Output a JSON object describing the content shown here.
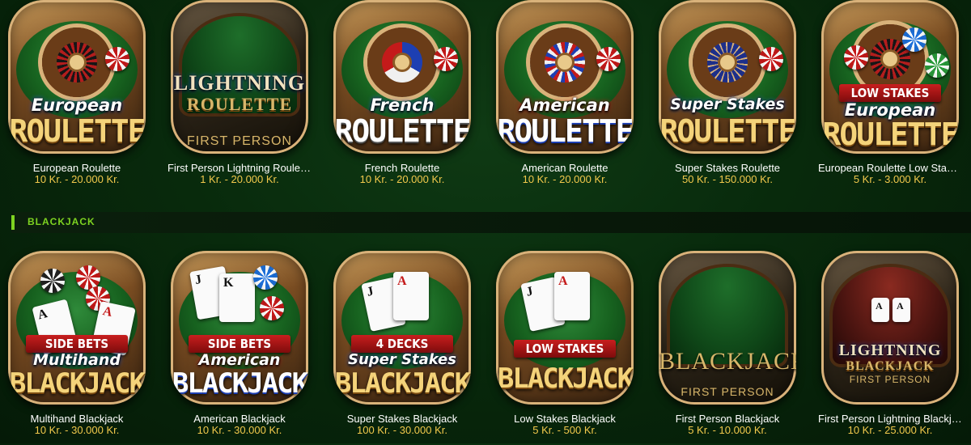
{
  "roulette_games": [
    {
      "badge_top": "European",
      "badge_main": "ROULETTE",
      "name": "European Roulette",
      "stakes": "10 Kr. - 20.000 Kr."
    },
    {
      "badge_top": "LIGHTNING",
      "badge_main": "ROULETTE",
      "badge_extra": "FIRST PERSON",
      "name": "First Person Lightning Roulette",
      "stakes": "1 Kr. - 20.000 Kr."
    },
    {
      "badge_top": "French",
      "badge_main": "ROULETTE",
      "name": "French Roulette",
      "stakes": "10 Kr. - 20.000 Kr."
    },
    {
      "badge_top": "American",
      "badge_main": "ROULETTE",
      "name": "American Roulette",
      "stakes": "10 Kr. - 20.000 Kr."
    },
    {
      "badge_top": "Super Stakes",
      "badge_main": "ROULETTE",
      "name": "Super Stakes Roulette",
      "stakes": "50 Kr. - 150.000 Kr."
    },
    {
      "badge_ribbon": "LOW STAKES",
      "badge_top": "European",
      "badge_main": "ROULETTE",
      "name": "European Roulette Low Stakes",
      "stakes": "5 Kr. - 3.000 Kr."
    }
  ],
  "section": {
    "label": "BLACKJACK",
    "accent_color": "#7ed321"
  },
  "blackjack_games": [
    {
      "badge_ribbon": "SIDE BETS",
      "badge_top": "Multihand",
      "badge_main": "BLACKJACK",
      "name": "Multihand Blackjack",
      "stakes": "10 Kr. - 30.000 Kr."
    },
    {
      "badge_ribbon": "SIDE BETS",
      "badge_top": "American",
      "badge_main": "BLACKJACK",
      "name": "American Blackjack",
      "stakes": "10 Kr. - 30.000 Kr."
    },
    {
      "badge_ribbon": "4 DECKS",
      "badge_top": "Super Stakes",
      "badge_main": "BLACKJACK",
      "name": "Super Stakes Blackjack",
      "stakes": "100 Kr. - 30.000 Kr."
    },
    {
      "badge_ribbon": "LOW STAKES",
      "badge_main": "BLACKJACK",
      "name": "Low Stakes Blackjack",
      "stakes": "5 Kr. - 500 Kr."
    },
    {
      "badge_main": "BLACKJACK",
      "badge_extra": "FIRST PERSON",
      "name": "First Person Blackjack",
      "stakes": "5 Kr. - 10.000 Kr."
    },
    {
      "badge_top": "LIGHTNING",
      "badge_main": "BLACKJACK",
      "badge_extra": "FIRST PERSON",
      "name": "First Person Lightning Blackja...",
      "stakes": "10 Kr. - 25.000 Kr."
    }
  ],
  "colors": {
    "stakes": "#f2c94c",
    "badge_gold": "#f4d37a",
    "background": "#082a0c"
  }
}
